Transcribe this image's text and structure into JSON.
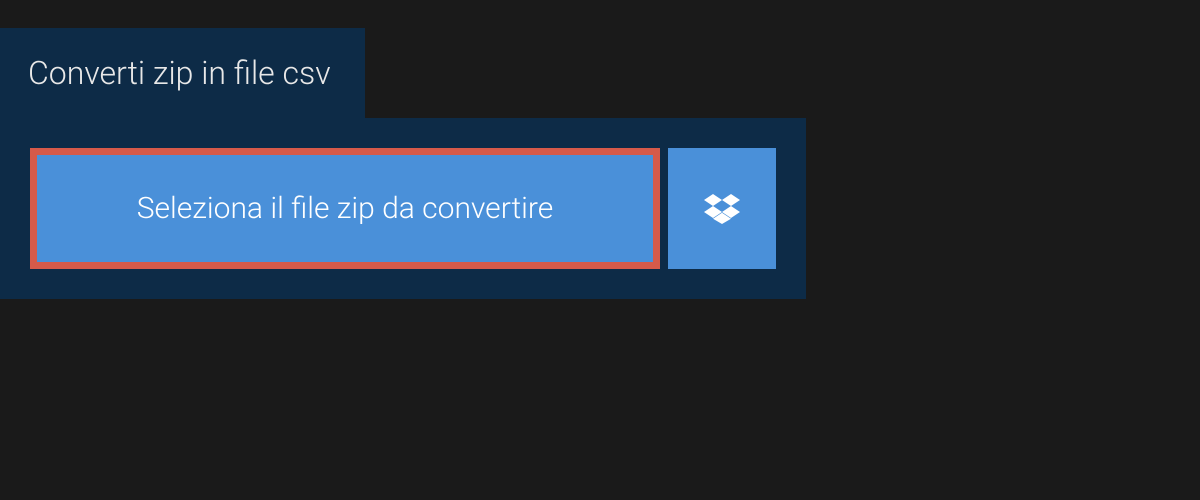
{
  "header": {
    "title": "Converti zip in file csv"
  },
  "actions": {
    "select_file_label": "Seleziona il file zip da convertire"
  },
  "colors": {
    "panel_bg": "#0d2b47",
    "button_bg": "#4a90d9",
    "highlight_border": "#d65a4a"
  }
}
